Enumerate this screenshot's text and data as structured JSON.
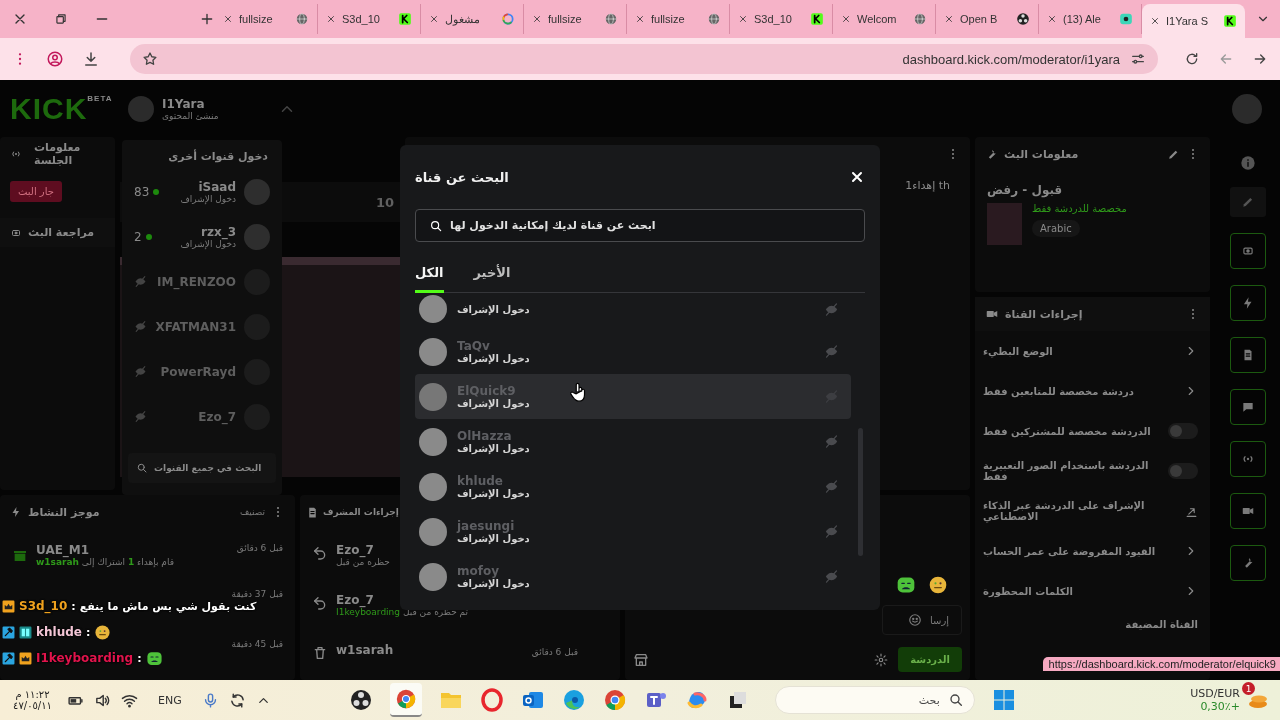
{
  "browser": {
    "tabs": [
      {
        "title": "I1Yara S",
        "kind": "kick",
        "selected": true
      },
      {
        "title": "(13) Ale",
        "kind": "app",
        "selected": false
      },
      {
        "title": "Open B",
        "kind": "obs",
        "selected": false
      },
      {
        "title": "Welcom",
        "kind": "globe",
        "selected": false
      },
      {
        "title": "S3d_10",
        "kind": "kick",
        "selected": false
      },
      {
        "title": "fullsize",
        "kind": "globe",
        "selected": false
      },
      {
        "title": "fullsize",
        "kind": "globe",
        "selected": false
      },
      {
        "title": "مشغول",
        "kind": "google",
        "selected": false
      },
      {
        "title": "S3d_10",
        "kind": "kick",
        "selected": false
      },
      {
        "title": "fullsize",
        "kind": "globe",
        "selected": false
      }
    ],
    "url": "dashboard.kick.com/moderator/i1yara"
  },
  "header": {
    "logo": "KICK",
    "logo_badge": "BETA",
    "user_name": "I1Yara",
    "user_role": "منشئ المحتوى"
  },
  "session_panel": {
    "title": "معلومات الجلسة",
    "live_button": "جار البث",
    "review": "مراجعة البث"
  },
  "stats": {
    "value": "10"
  },
  "chat_panel": {
    "gift_note": "1إهداء th",
    "input_placeholder": "إرسا",
    "send_button": "الدردشة"
  },
  "activity": {
    "title": "موجز النشاط",
    "filter": "تصنيف",
    "items": [
      {
        "user": "UAE_M1",
        "time": "قبل 6 دقائق",
        "before": "قام بإهداء",
        "count": "1",
        "middle": "اشتراك إلى",
        "target": "w1sarah"
      },
      {
        "time": "قبل 37 دقيقة"
      },
      {
        "time": "قبل 45 دقيقة"
      }
    ]
  },
  "mod_actions": {
    "title": "إجراءات المشرف",
    "items": [
      {
        "kind": "unban",
        "user": "Ezo_7",
        "detail": "حظره من قبل"
      },
      {
        "kind": "ban",
        "user": "Ezo_7",
        "detail": "تم حظره من قبل",
        "by": "I1keyboarding"
      },
      {
        "kind": "delete",
        "user": "w1sarah",
        "time": "قبل 6 دقائق"
      }
    ]
  },
  "stream_info": {
    "title": "معلومات البث",
    "stream_title": "قبول - رفض",
    "category": "مخصصة للدردشة فقط",
    "language": "Arabic"
  },
  "channel_actions": {
    "title": "إجراءات القناة",
    "items": [
      {
        "kind": "submenu",
        "label": "الوضع البطيء"
      },
      {
        "kind": "submenu",
        "label": "دردشة مخصصة للمتابعين فقط"
      },
      {
        "kind": "toggle",
        "label": "الدردشة مخصصة للمشتركين فقط",
        "on": false
      },
      {
        "kind": "toggle",
        "label": "الدردشة باستخدام الصور التعبيرية فقط",
        "on": false
      },
      {
        "kind": "link",
        "label": "الإشراف على الدردشة عبر الذكاء الاصطناعي"
      },
      {
        "kind": "submenu",
        "label": "القيود المفروضة على عمر الحساب"
      },
      {
        "kind": "submenu",
        "label": "الكلمات المحظورة"
      }
    ],
    "footer": "القناة المضيفة"
  },
  "channel_switcher": {
    "title": "دخول قنوات أخرى",
    "channels": [
      {
        "name": "iSaad",
        "live": true,
        "viewers": "83",
        "subtitle": "دخول الإشراف"
      },
      {
        "name": "rzx_3",
        "live": true,
        "viewers": "2",
        "subtitle": "دخول الإشراف"
      },
      {
        "name": "IM_RENZOO",
        "live": false
      },
      {
        "name": "XFATMAN31",
        "live": false
      },
      {
        "name": "PowerRayd",
        "live": false
      },
      {
        "name": "Ezo_7",
        "live": false
      }
    ],
    "search": "البحث في جميع القنوات"
  },
  "search_modal": {
    "title": "البحث عن قناة",
    "placeholder": "ابحث عن قناة لديك إمكانية الدخول لها",
    "tabs": [
      {
        "label": "الأخير",
        "selected": false
      },
      {
        "label": "الكل",
        "selected": true
      }
    ],
    "results": [
      {
        "subtitle": "دخول الإشراف",
        "hovered": false
      },
      {
        "name": "TaQv",
        "subtitle": "دخول الإشراف",
        "hovered": false
      },
      {
        "name": "ElQuick9",
        "subtitle": "دخول الإشراف",
        "hovered": true
      },
      {
        "name": "OlHazza",
        "subtitle": "دخول الإشراف",
        "hovered": false
      },
      {
        "name": "khlude",
        "subtitle": "دخول الإشراف",
        "hovered": false
      },
      {
        "name": "jaesungi",
        "subtitle": "دخول الإشراف",
        "hovered": false
      },
      {
        "name": "mofoy",
        "subtitle": "دخول الإشراف",
        "hovered": false
      }
    ]
  },
  "chat_overlay": {
    "messages": [
      {
        "moderator": false,
        "og": false,
        "vip": true,
        "user": "S3d_10",
        "color": "#f0a21e",
        "separator": ":",
        "kind": "text",
        "text": "كنت بقول شي بس ماش ما ينفع"
      },
      {
        "moderator": true,
        "og": true,
        "vip": false,
        "user": "khlude",
        "color": "#f3c6d6",
        "separator": ":",
        "kind": "emoji"
      },
      {
        "moderator": true,
        "og": false,
        "vip": true,
        "user": "I1keyboarding",
        "color": "#e0144c",
        "separator": ":",
        "kind": "emoji"
      }
    ]
  },
  "status_url": "https://dashboard.kick.com/moderator/elquick9",
  "taskbar": {
    "time": "١١:٢٢ م",
    "date": "٤٧/٠٥/١١",
    "language": "ENG",
    "search_placeholder": "بحث",
    "ticker": "USD/EUR",
    "change": "0,30٪+",
    "notification_count": "1"
  }
}
